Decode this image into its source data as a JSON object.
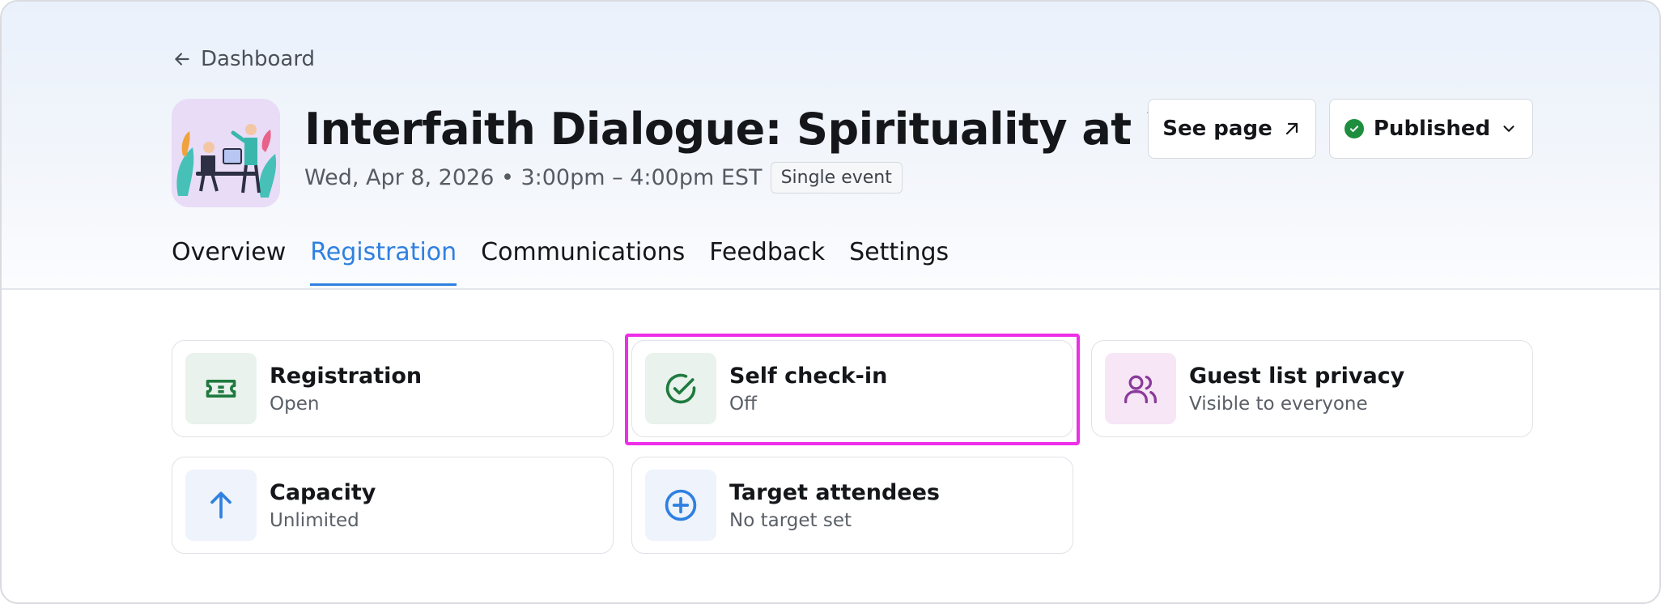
{
  "header": {
    "back_label": "Dashboard",
    "title": "Interfaith Dialogue: Spirituality at Work",
    "datetime": "Wed, Apr 8, 2026 • 3:00pm – 4:00pm EST",
    "event_type_badge": "Single event",
    "see_page_label": "See page",
    "status_label": "Published"
  },
  "tabs": [
    {
      "label": "Overview",
      "active": false
    },
    {
      "label": "Registration",
      "active": true
    },
    {
      "label": "Communications",
      "active": false
    },
    {
      "label": "Feedback",
      "active": false
    },
    {
      "label": "Settings",
      "active": false
    }
  ],
  "cards": [
    {
      "id": "registration",
      "title": "Registration",
      "value": "Open",
      "icon": "ticket-icon"
    },
    {
      "id": "self-check-in",
      "title": "Self check-in",
      "value": "Off",
      "icon": "check-circle-icon"
    },
    {
      "id": "guest-list-privacy",
      "title": "Guest list privacy",
      "value": "Visible to everyone",
      "icon": "users-icon"
    },
    {
      "id": "capacity",
      "title": "Capacity",
      "value": "Unlimited",
      "icon": "arrow-up-icon"
    },
    {
      "id": "target-attendees",
      "title": "Target attendees",
      "value": "No target set",
      "icon": "plus-circle-icon"
    }
  ],
  "colors": {
    "accent": "#2f80e0",
    "published_green": "#1e8e3e",
    "highlight": "#ee2ee8"
  }
}
